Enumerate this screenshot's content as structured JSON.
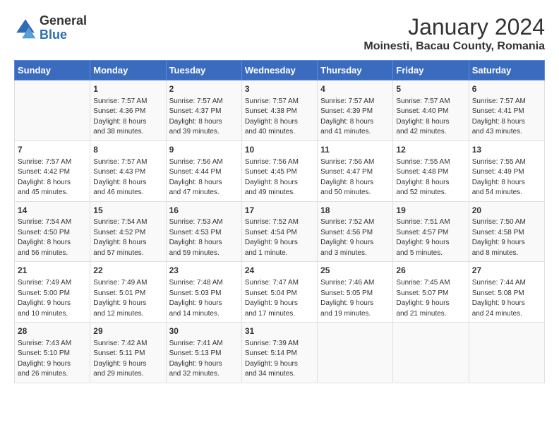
{
  "header": {
    "logo_line1": "General",
    "logo_line2": "Blue",
    "title": "January 2024",
    "subtitle": "Moinesti, Bacau County, Romania"
  },
  "calendar": {
    "days_of_week": [
      "Sunday",
      "Monday",
      "Tuesday",
      "Wednesday",
      "Thursday",
      "Friday",
      "Saturday"
    ],
    "weeks": [
      [
        {
          "day": "",
          "info": ""
        },
        {
          "day": "1",
          "info": "Sunrise: 7:57 AM\nSunset: 4:36 PM\nDaylight: 8 hours\nand 38 minutes."
        },
        {
          "day": "2",
          "info": "Sunrise: 7:57 AM\nSunset: 4:37 PM\nDaylight: 8 hours\nand 39 minutes."
        },
        {
          "day": "3",
          "info": "Sunrise: 7:57 AM\nSunset: 4:38 PM\nDaylight: 8 hours\nand 40 minutes."
        },
        {
          "day": "4",
          "info": "Sunrise: 7:57 AM\nSunset: 4:39 PM\nDaylight: 8 hours\nand 41 minutes."
        },
        {
          "day": "5",
          "info": "Sunrise: 7:57 AM\nSunset: 4:40 PM\nDaylight: 8 hours\nand 42 minutes."
        },
        {
          "day": "6",
          "info": "Sunrise: 7:57 AM\nSunset: 4:41 PM\nDaylight: 8 hours\nand 43 minutes."
        }
      ],
      [
        {
          "day": "7",
          "info": "Sunrise: 7:57 AM\nSunset: 4:42 PM\nDaylight: 8 hours\nand 45 minutes."
        },
        {
          "day": "8",
          "info": "Sunrise: 7:57 AM\nSunset: 4:43 PM\nDaylight: 8 hours\nand 46 minutes."
        },
        {
          "day": "9",
          "info": "Sunrise: 7:56 AM\nSunset: 4:44 PM\nDaylight: 8 hours\nand 47 minutes."
        },
        {
          "day": "10",
          "info": "Sunrise: 7:56 AM\nSunset: 4:45 PM\nDaylight: 8 hours\nand 49 minutes."
        },
        {
          "day": "11",
          "info": "Sunrise: 7:56 AM\nSunset: 4:47 PM\nDaylight: 8 hours\nand 50 minutes."
        },
        {
          "day": "12",
          "info": "Sunrise: 7:55 AM\nSunset: 4:48 PM\nDaylight: 8 hours\nand 52 minutes."
        },
        {
          "day": "13",
          "info": "Sunrise: 7:55 AM\nSunset: 4:49 PM\nDaylight: 8 hours\nand 54 minutes."
        }
      ],
      [
        {
          "day": "14",
          "info": "Sunrise: 7:54 AM\nSunset: 4:50 PM\nDaylight: 8 hours\nand 56 minutes."
        },
        {
          "day": "15",
          "info": "Sunrise: 7:54 AM\nSunset: 4:52 PM\nDaylight: 8 hours\nand 57 minutes."
        },
        {
          "day": "16",
          "info": "Sunrise: 7:53 AM\nSunset: 4:53 PM\nDaylight: 8 hours\nand 59 minutes."
        },
        {
          "day": "17",
          "info": "Sunrise: 7:52 AM\nSunset: 4:54 PM\nDaylight: 9 hours\nand 1 minute."
        },
        {
          "day": "18",
          "info": "Sunrise: 7:52 AM\nSunset: 4:56 PM\nDaylight: 9 hours\nand 3 minutes."
        },
        {
          "day": "19",
          "info": "Sunrise: 7:51 AM\nSunset: 4:57 PM\nDaylight: 9 hours\nand 5 minutes."
        },
        {
          "day": "20",
          "info": "Sunrise: 7:50 AM\nSunset: 4:58 PM\nDaylight: 9 hours\nand 8 minutes."
        }
      ],
      [
        {
          "day": "21",
          "info": "Sunrise: 7:49 AM\nSunset: 5:00 PM\nDaylight: 9 hours\nand 10 minutes."
        },
        {
          "day": "22",
          "info": "Sunrise: 7:49 AM\nSunset: 5:01 PM\nDaylight: 9 hours\nand 12 minutes."
        },
        {
          "day": "23",
          "info": "Sunrise: 7:48 AM\nSunset: 5:03 PM\nDaylight: 9 hours\nand 14 minutes."
        },
        {
          "day": "24",
          "info": "Sunrise: 7:47 AM\nSunset: 5:04 PM\nDaylight: 9 hours\nand 17 minutes."
        },
        {
          "day": "25",
          "info": "Sunrise: 7:46 AM\nSunset: 5:05 PM\nDaylight: 9 hours\nand 19 minutes."
        },
        {
          "day": "26",
          "info": "Sunrise: 7:45 AM\nSunset: 5:07 PM\nDaylight: 9 hours\nand 21 minutes."
        },
        {
          "day": "27",
          "info": "Sunrise: 7:44 AM\nSunset: 5:08 PM\nDaylight: 9 hours\nand 24 minutes."
        }
      ],
      [
        {
          "day": "28",
          "info": "Sunrise: 7:43 AM\nSunset: 5:10 PM\nDaylight: 9 hours\nand 26 minutes."
        },
        {
          "day": "29",
          "info": "Sunrise: 7:42 AM\nSunset: 5:11 PM\nDaylight: 9 hours\nand 29 minutes."
        },
        {
          "day": "30",
          "info": "Sunrise: 7:41 AM\nSunset: 5:13 PM\nDaylight: 9 hours\nand 32 minutes."
        },
        {
          "day": "31",
          "info": "Sunrise: 7:39 AM\nSunset: 5:14 PM\nDaylight: 9 hours\nand 34 minutes."
        },
        {
          "day": "",
          "info": ""
        },
        {
          "day": "",
          "info": ""
        },
        {
          "day": "",
          "info": ""
        }
      ]
    ]
  }
}
